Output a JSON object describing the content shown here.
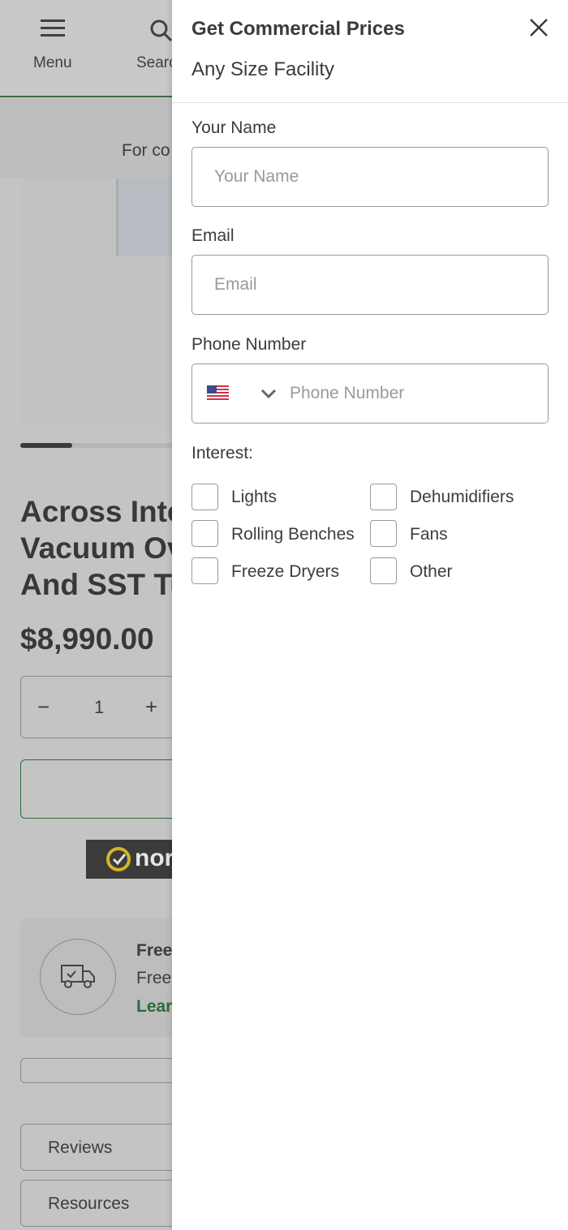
{
  "background_page": {
    "nav": {
      "menu_label": "Menu",
      "search_label": "Searc"
    },
    "banner_text": "For co",
    "product_title_lines": [
      "Across Inte",
      "Vacuum Ov",
      "And SST Tu"
    ],
    "price": "$8,990.00",
    "quantity": {
      "minus": "−",
      "value": "1",
      "plus": "+"
    },
    "badge_text": "nor",
    "shipping": {
      "title": "Free",
      "subtitle": "Free",
      "link": "Lear"
    },
    "tabs": [
      "Reviews",
      "Resources"
    ]
  },
  "drawer": {
    "title": "Get Commercial Prices",
    "subtitle": "Any Size Facility",
    "close_icon": "close-x",
    "fields": [
      {
        "label": "Your Name",
        "placeholder": "Your Name"
      },
      {
        "label": "Email",
        "placeholder": "Email"
      },
      {
        "label": "Phone Number",
        "placeholder": "Phone Number",
        "country": "US"
      }
    ],
    "interest_label": "Interest:",
    "interests": [
      {
        "label": "Lights",
        "checked": false
      },
      {
        "label": "Dehumidifiers",
        "checked": false
      },
      {
        "label": "Rolling Benches",
        "checked": false
      },
      {
        "label": "Fans",
        "checked": false
      },
      {
        "label": "Freeze Dryers",
        "checked": false
      },
      {
        "label": "Other",
        "checked": false
      }
    ]
  },
  "colors": {
    "accent_green": "#2e6b3a",
    "overlay_gray": "#c4c4c4"
  }
}
